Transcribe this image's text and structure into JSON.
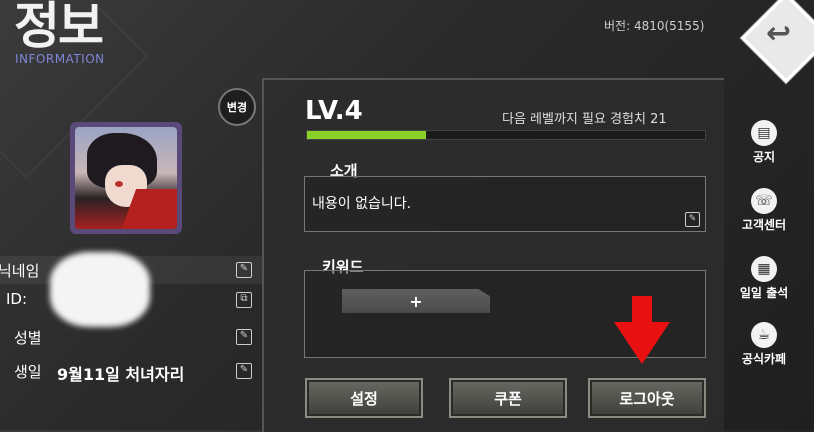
{
  "header": {
    "title": "정보",
    "subtitle": "INFORMATION",
    "version": "버전: 4810(5155)",
    "back_icon": "back-arrow-icon"
  },
  "profile": {
    "change_label": "변경",
    "nickname_label": "닉네임",
    "id_label": "ID:",
    "gender_label": "성별",
    "birth_label": "생일",
    "birth_value": "9월11일 처녀자리"
  },
  "level": {
    "label": "LV.4",
    "next_exp": "다음 레벨까지 필요 경험치 21",
    "progress_fraction": 0.3
  },
  "intro": {
    "title": "소개",
    "text": "내용이 없습니다."
  },
  "keywords": {
    "title": "키워드",
    "add_label": "+"
  },
  "buttons": {
    "settings": "설정",
    "coupon": "쿠폰",
    "logout": "로그아웃"
  },
  "side_menu": [
    {
      "label": "공지",
      "icon": "notice-icon"
    },
    {
      "label": "고객센터",
      "icon": "customer-center-icon"
    },
    {
      "label": "일일 출석",
      "icon": "daily-attendance-icon"
    },
    {
      "label": "공식카페",
      "icon": "official-cafe-icon"
    }
  ],
  "colors": {
    "exp_bar": "#8ad12a",
    "annotation_arrow": "#e81010",
    "subtitle": "#7f86d8"
  }
}
